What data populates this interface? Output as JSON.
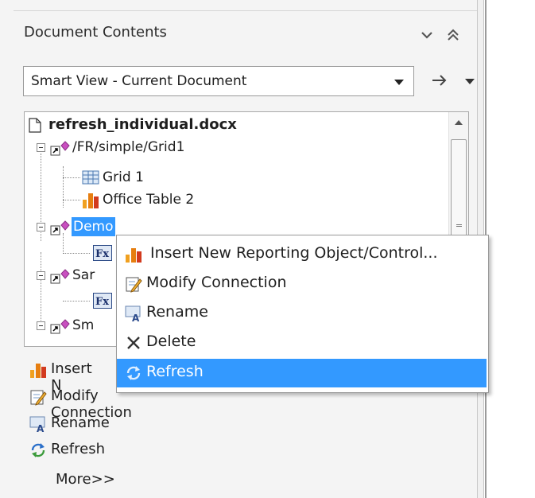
{
  "panel": {
    "title": "Document Contents",
    "view_selector": "Smart View - Current Document"
  },
  "tree": {
    "root": "refresh_individual.docx",
    "items": [
      {
        "label": "/FR/simple/Grid1"
      },
      {
        "label": "Grid 1"
      },
      {
        "label": "Office Table 2"
      },
      {
        "label": "Demo"
      },
      {
        "label": "Sar"
      },
      {
        "label": "Sm"
      }
    ]
  },
  "context_menu": {
    "items": [
      {
        "label": "Insert New Reporting Object/Control..."
      },
      {
        "label": "Modify Connection"
      },
      {
        "label": "Rename"
      },
      {
        "label": "Delete"
      },
      {
        "label": "Refresh"
      }
    ]
  },
  "tasks": {
    "items": [
      {
        "label": "Insert N"
      },
      {
        "label": "Modify Connection"
      },
      {
        "label": "Rename"
      },
      {
        "label": "Refresh"
      }
    ],
    "more": "More>>"
  },
  "colors": {
    "selection": "#3399ff",
    "panel_bg": "#f4f4f4"
  },
  "icons": {
    "collapse": "chevron-down-icon",
    "minimize": "double-chevron-up-icon",
    "go": "arrow-right-icon",
    "document": "document-icon",
    "connection": "connection-icon",
    "grid": "grid-icon",
    "office_table": "chart-icon",
    "function": "fx-icon",
    "modify": "edit-icon",
    "rename": "rename-icon",
    "delete": "x-icon",
    "refresh": "refresh-icon"
  }
}
